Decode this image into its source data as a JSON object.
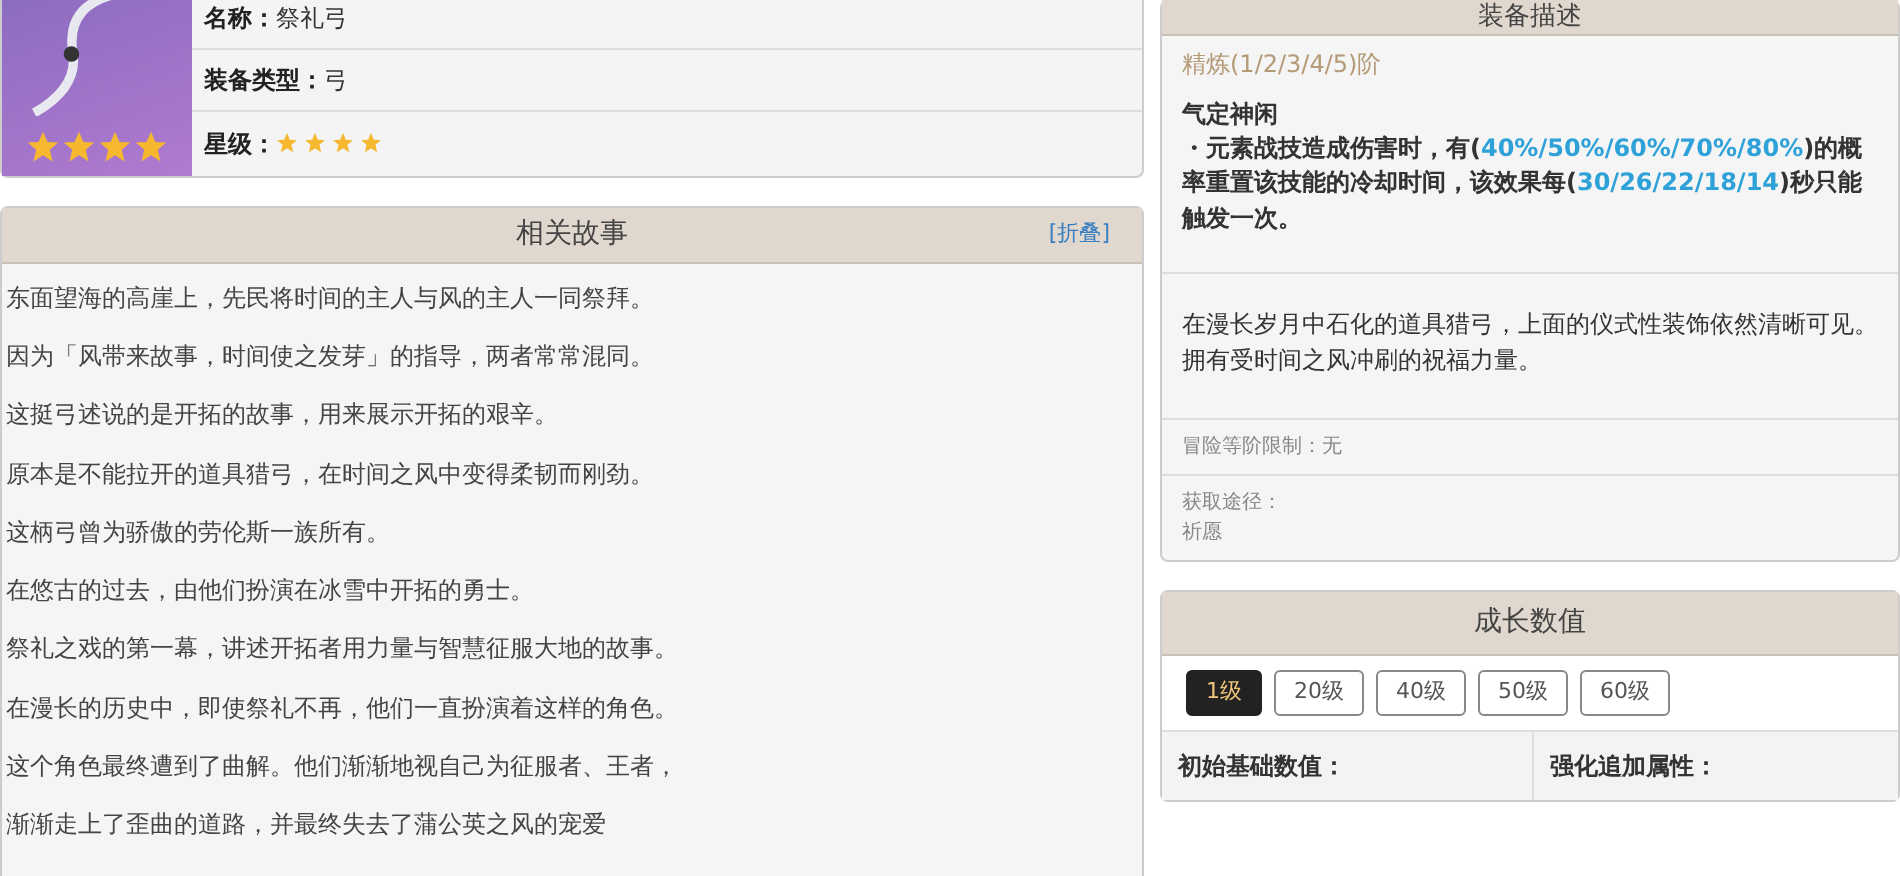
{
  "weapon_info": {
    "portrait": {
      "stars": 4
    },
    "rows": [
      {
        "kind": "text",
        "label": "名称：",
        "value": "祭礼弓"
      },
      {
        "kind": "text",
        "label": "装备类型：",
        "value": "弓"
      },
      {
        "kind": "stars",
        "label": "星级：",
        "stars": 4
      }
    ]
  },
  "story": {
    "title": "相关故事",
    "toggle": "[折叠]",
    "lines": [
      "东面望海的高崖上，先民将时间的主人与风的主人一同祭拜。",
      "因为「风带来故事，时间使之发芽」的指导，两者常常混同。",
      "这挺弓述说的是开拓的故事，用来展示开拓的艰辛。",
      "原本是不能拉开的道具猎弓，在时间之风中变得柔韧而刚劲。",
      "这柄弓曾为骄傲的劳伦斯一族所有。",
      "在悠古的过去，由他们扮演在冰雪中开拓的勇士。",
      "祭礼之戏的第一幕，讲述开拓者用力量与智慧征服大地的故事。",
      "在漫长的历史中，即使祭礼不再，他们一直扮演着这样的角色。",
      "这个角色最终遭到了曲解。他们渐渐地视自己为征服者、王者，",
      "渐渐走上了歪曲的道路，并最终失去了蒲公英之风的宠爱"
    ]
  },
  "description": {
    "title": "装备描述",
    "refine": "精炼(1/2/3/4/5)阶",
    "skill_name": "气定神闲",
    "skill_text": [
      {
        "text": "・元素战技造成伤害时，有(",
        "highlight": false
      },
      {
        "text": "40%/50%/60%/70%/80%",
        "highlight": true
      },
      {
        "text": ")的概率重置该技能的冷却时间，该效果每(",
        "highlight": false
      },
      {
        "text": "30/26/22/18/14",
        "highlight": true
      },
      {
        "text": ")秒只能触发一次。",
        "highlight": false
      }
    ],
    "flavor": "在漫长岁月中石化的道具猎弓，上面的仪式性装饰依然清晰可见。拥有受时间之风冲刷的祝福力量。",
    "level_limit": "冒险等阶限制：无",
    "source_label": "获取途径：",
    "source": "祈愿"
  },
  "growth": {
    "title": "成长数值",
    "levels": [
      {
        "label": "1级",
        "selected": true
      },
      {
        "label": "20级",
        "selected": false
      },
      {
        "label": "40级",
        "selected": false
      },
      {
        "label": "50级",
        "selected": false
      },
      {
        "label": "60级",
        "selected": false
      }
    ],
    "columns": [
      "初始基础数值：",
      "强化追加属性："
    ]
  }
}
